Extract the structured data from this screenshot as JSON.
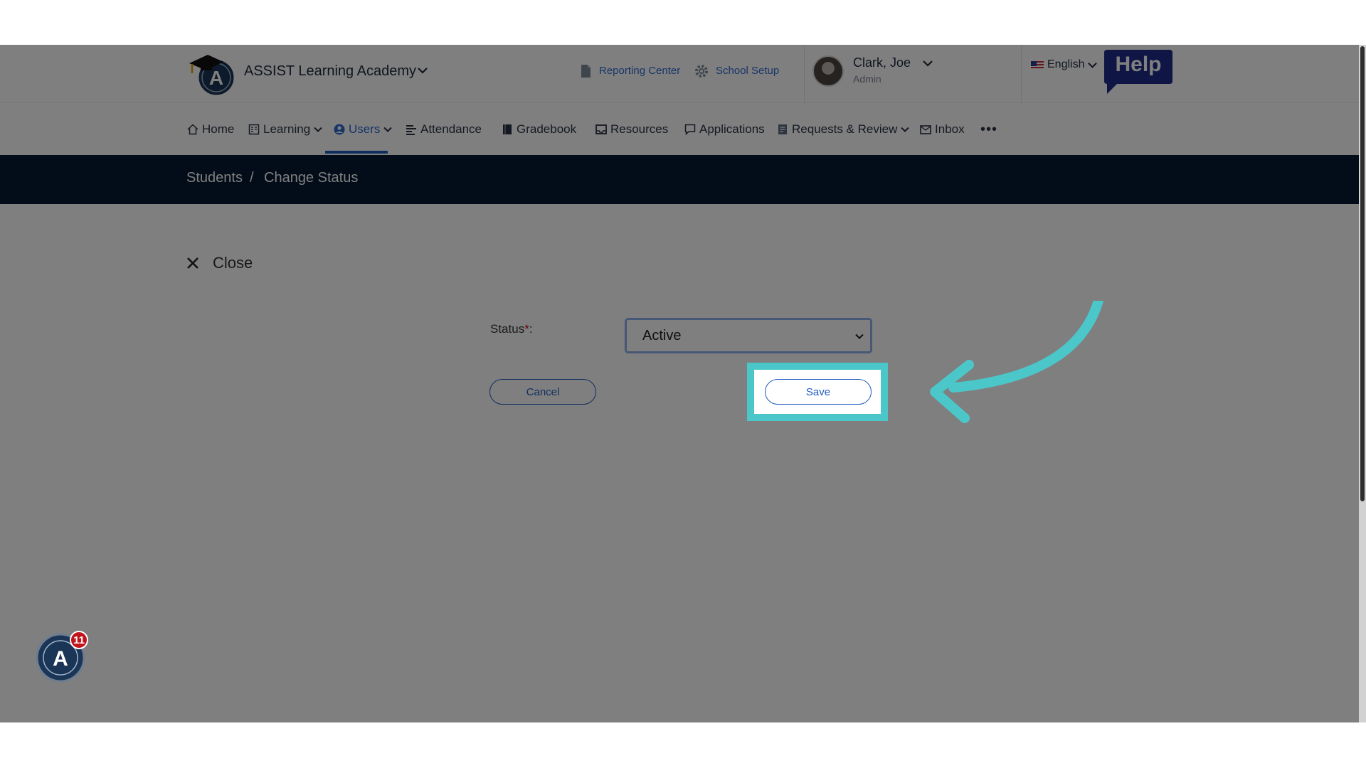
{
  "header": {
    "school_name": "ASSIST Learning Academy",
    "reporting_center": "Reporting Center",
    "school_setup": "School Setup",
    "user_name": "Clark, Joe",
    "user_role": "Admin",
    "language": "English",
    "help_label": "Help"
  },
  "nav": {
    "items": [
      {
        "label": "Home",
        "icon": "home-icon"
      },
      {
        "label": "Learning",
        "icon": "learning-icon"
      },
      {
        "label": "Users",
        "icon": "user-circle-icon",
        "active": true
      },
      {
        "label": "Attendance",
        "icon": "attendance-icon"
      },
      {
        "label": "Gradebook",
        "icon": "book-icon"
      },
      {
        "label": "Resources",
        "icon": "inbox-tray-icon"
      },
      {
        "label": "Applications",
        "icon": "chat-icon"
      },
      {
        "label": "Requests & Review",
        "icon": "document-icon"
      },
      {
        "label": "Inbox",
        "icon": "mail-icon"
      }
    ],
    "more": "•••"
  },
  "breadcrumb": {
    "parent": "Students",
    "separator": "/",
    "current": "Change Status"
  },
  "form": {
    "close_label": "Close",
    "status_label": "Status",
    "required_mark": "*",
    "label_suffix": ":",
    "status_value": "Active",
    "cancel_label": "Cancel",
    "save_label": "Save"
  },
  "widget": {
    "notification_count": "11"
  },
  "colors": {
    "accent": "#1f5cc0",
    "breadcrumb_bg": "#061b33",
    "highlight": "#4cc7c9"
  }
}
